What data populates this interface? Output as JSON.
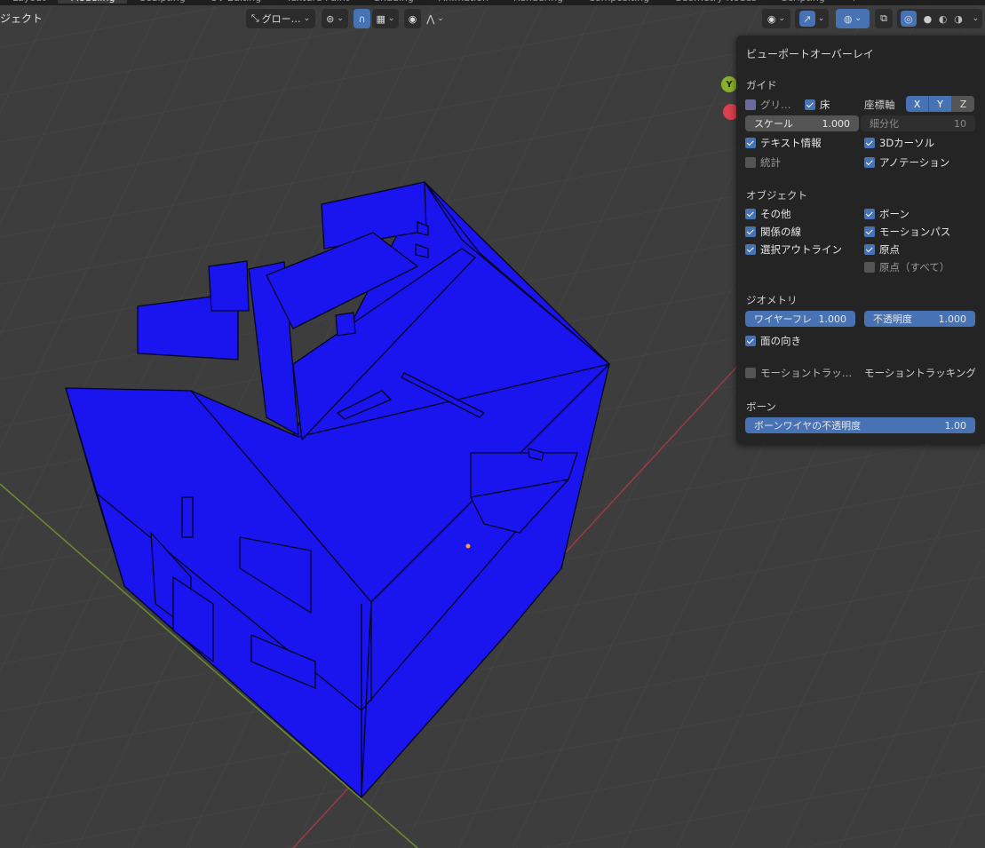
{
  "workspace_tabs": [
    "Layout",
    "Modeling",
    "Sculpting",
    "UV Editing",
    "Texture Paint",
    "Shading",
    "Animation",
    "Rendering",
    "Compositing",
    "Geometry Nodes",
    "Scripting",
    "+"
  ],
  "active_tab_index": 1,
  "header": {
    "mode_label": "ジェクト",
    "orientation_label": "グロー…"
  },
  "gizmo": {
    "y_label": "Y"
  },
  "overlay_panel": {
    "title": "ビューポートオーバーレイ",
    "guides": {
      "heading": "ガイド",
      "grid_label": "グリ…",
      "floor_label": "床",
      "axis_label": "座標軸",
      "axes": [
        "X",
        "Y",
        "Z"
      ],
      "scale_label": "スケール",
      "scale_value": "1.000",
      "subdiv_label": "細分化",
      "subdiv_value": "10",
      "text_info_label": "テキスト情報",
      "cursor_label": "3Dカーソル",
      "stats_label": "統計",
      "annotation_label": "アノテーション"
    },
    "objects": {
      "heading": "オブジェクト",
      "extras_label": "その他",
      "bones_label": "ボーン",
      "relations_label": "関係の線",
      "motion_paths_label": "モーションパス",
      "outline_label": "選択アウトライン",
      "origins_label": "原点",
      "origins_all_label": "原点（すべて）"
    },
    "geometry": {
      "heading": "ジオメトリ",
      "wireframe_label": "ワイヤーフレ",
      "wireframe_value": "1.000",
      "opacity_label": "不透明度",
      "opacity_value": "1.000",
      "face_orientation_label": "面の向き"
    },
    "motion_tracking": {
      "checkbox_label": "モーショントラッ…",
      "label": "モーショントラッキング"
    },
    "bones": {
      "heading": "ボーン",
      "wire_opacity_label": "ボーンワイヤの不透明度",
      "wire_opacity_value": "1.00"
    }
  },
  "colors": {
    "accent": "#4772b3",
    "mesh": "#1a14ee",
    "panel_bg": "#242424",
    "viewport_bg": "#3d3d3d"
  }
}
